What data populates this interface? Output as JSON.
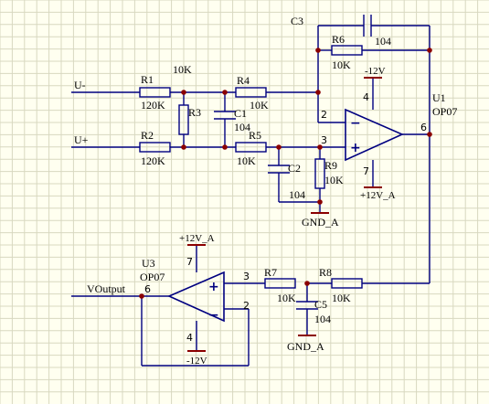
{
  "nets": {
    "u_minus": "U-",
    "u_plus": "U+",
    "voutput": "VOutput"
  },
  "u1": {
    "ref": "U1",
    "value": "OP07",
    "pin_inv": "2",
    "pin_noninv": "3",
    "pin_out": "6",
    "pin_vneg": "4",
    "pin_vpos": "7",
    "vneg": "-12V",
    "vpos": "+12V_A"
  },
  "u3": {
    "ref": "U3",
    "value": "OP07",
    "pin_noninv": "3",
    "pin_inv": "2",
    "pin_out": "6",
    "pin_vpos": "7",
    "pin_vneg": "4",
    "vpos": "+12V_A",
    "vneg": "-12V"
  },
  "r1": {
    "ref": "R1",
    "value": "120K"
  },
  "r2": {
    "ref": "R2",
    "value": "120K"
  },
  "r3": {
    "ref": "R3",
    "value": "10K"
  },
  "r4": {
    "ref": "R4",
    "value": "10K"
  },
  "r5": {
    "ref": "R5",
    "value": "10K"
  },
  "r6": {
    "ref": "R6",
    "value": "10K"
  },
  "r7": {
    "ref": "R7",
    "value": "10K"
  },
  "r8": {
    "ref": "R8",
    "value": "10K"
  },
  "r9": {
    "ref": "R9",
    "value": "10K"
  },
  "c1": {
    "ref": "C1",
    "value": "104"
  },
  "c2": {
    "ref": "C2",
    "value": "104"
  },
  "c3": {
    "ref": "C3",
    "value": "104"
  },
  "c5": {
    "ref": "C5",
    "value": "104"
  },
  "gnd1": "GND_A",
  "gnd2": "GND_A",
  "colors": {
    "background": "#fffff0",
    "grid": "#d8d8c0",
    "wire": "#000080",
    "junction": "#8b0000"
  }
}
